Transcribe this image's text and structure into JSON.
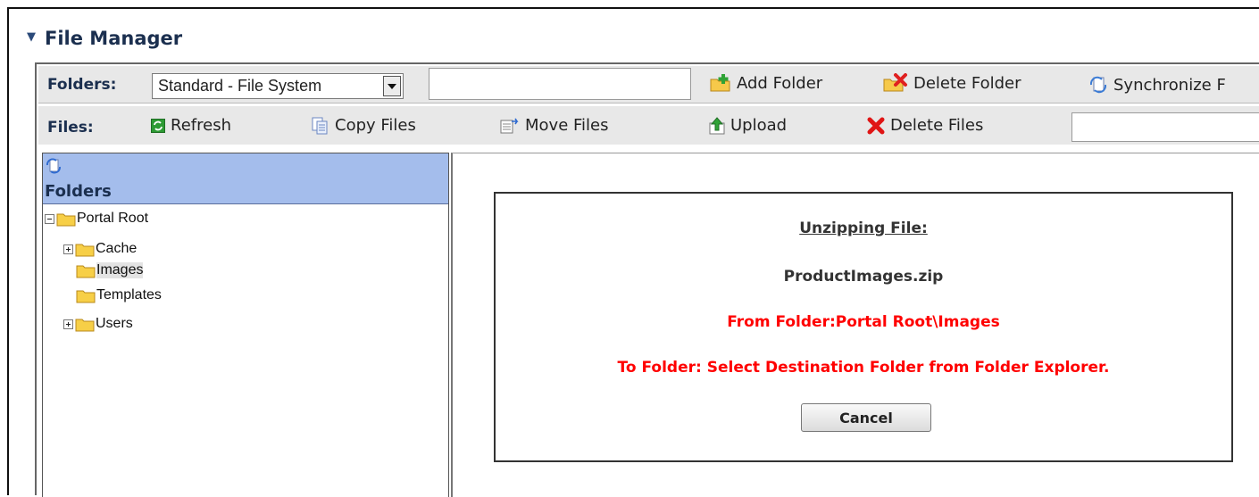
{
  "module": {
    "title": "File Manager"
  },
  "folders_toolbar": {
    "label": "Folders:",
    "folder_type": "Standard - File System",
    "folder_name_value": "",
    "add_folder": "Add Folder",
    "delete_folder": "Delete Folder",
    "synchronize": "Synchronize F"
  },
  "files_toolbar": {
    "label": "Files:",
    "refresh": "Refresh",
    "copy_files": "Copy Files",
    "move_files": "Move Files",
    "upload": "Upload",
    "delete_files": "Delete Files",
    "filter_value": ""
  },
  "explorer": {
    "header": "Folders",
    "tree": [
      {
        "label": "Portal Root",
        "toggle": "minus"
      },
      {
        "label": "Cache",
        "toggle": "plus"
      },
      {
        "label": "Images",
        "toggle": "none",
        "selected": true
      },
      {
        "label": "Templates",
        "toggle": "none"
      },
      {
        "label": "Users",
        "toggle": "plus"
      }
    ]
  },
  "dialog": {
    "title": "Unzipping File:",
    "filename": "ProductImages.zip",
    "from": "From Folder:Portal Root\\Images",
    "to": "To Folder: Select Destination Folder from Folder Explorer.",
    "cancel": "Cancel"
  },
  "colors": {
    "header_text": "#1b2f4f",
    "toolbar_bg": "#e8e8e8",
    "explorer_header_bg": "#a4bdec",
    "warning": "#ff0000"
  },
  "icons": {
    "collapse": "triangle-down-icon",
    "add_folder": "folder-add-icon",
    "delete_folder": "folder-delete-icon",
    "synchronize": "sync-icon",
    "refresh": "refresh-icon",
    "copy": "copy-icon",
    "move": "move-icon",
    "upload": "upload-icon",
    "delete": "red-x-icon",
    "folder": "folder-icon"
  }
}
